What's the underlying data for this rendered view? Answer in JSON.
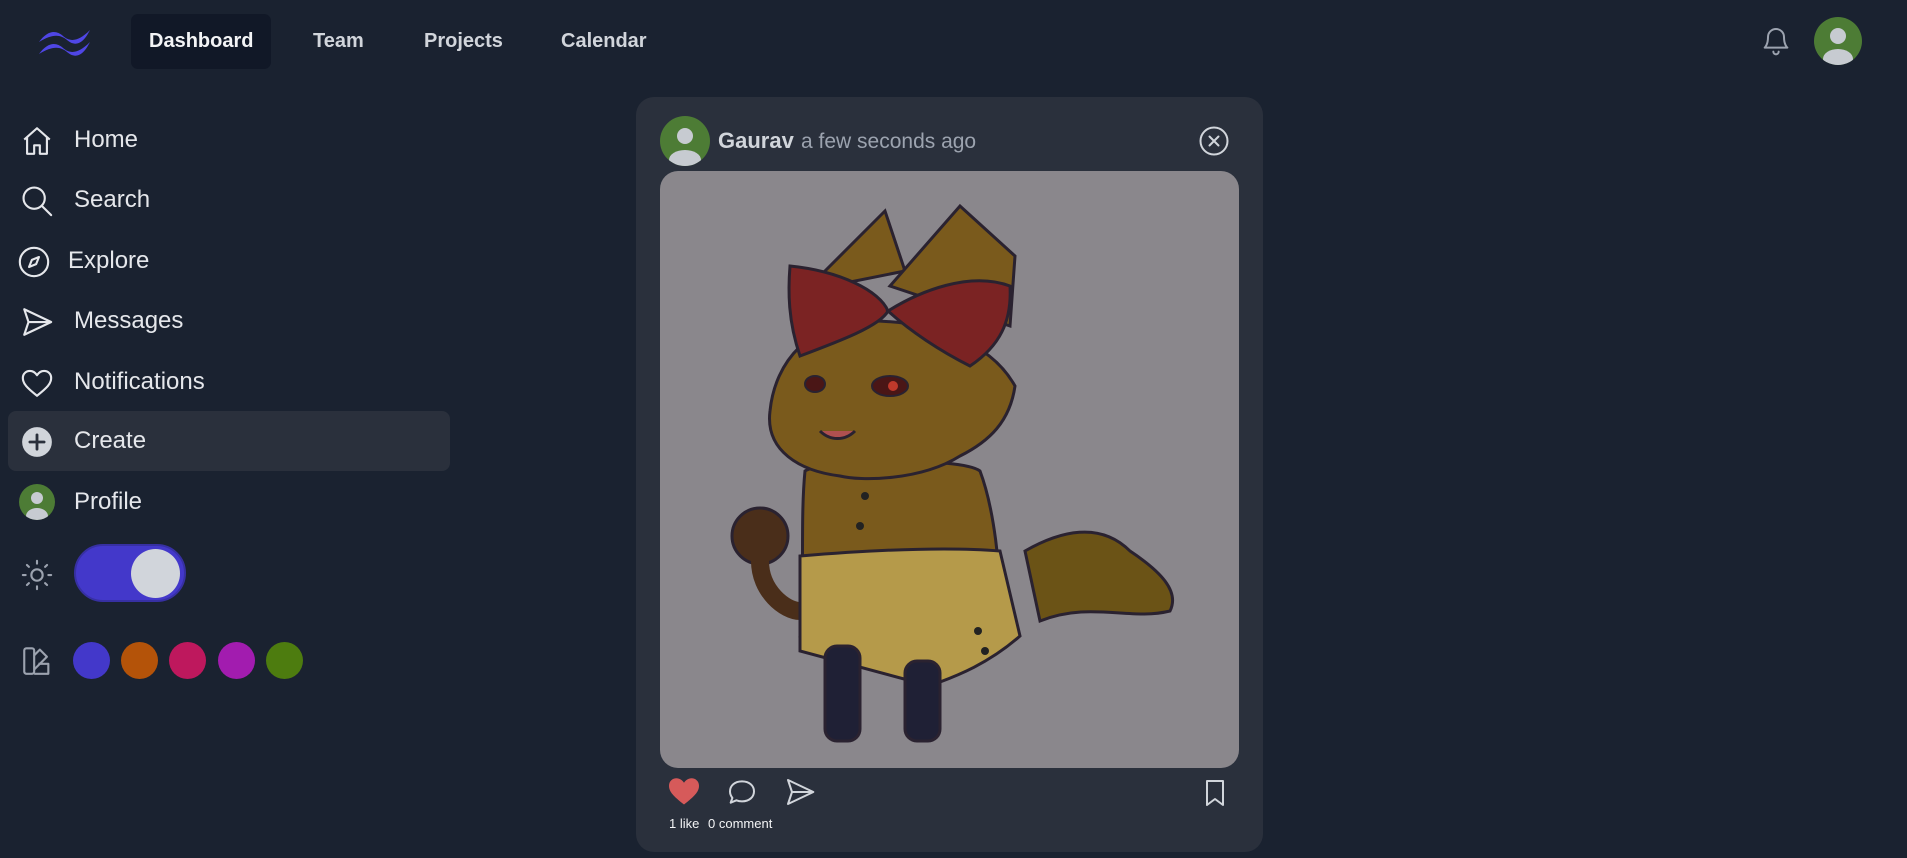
{
  "nav": {
    "tabs": [
      {
        "label": "Dashboard",
        "active": true
      },
      {
        "label": "Team"
      },
      {
        "label": "Projects"
      },
      {
        "label": "Calendar"
      }
    ]
  },
  "sidebar": {
    "items": [
      {
        "label": "Home",
        "icon": "home-icon"
      },
      {
        "label": "Search",
        "icon": "search-icon"
      },
      {
        "label": "Explore",
        "icon": "compass-icon"
      },
      {
        "label": "Messages",
        "icon": "send-icon"
      },
      {
        "label": "Notifications",
        "icon": "heart-icon"
      },
      {
        "label": "Create",
        "icon": "plus-circle-icon",
        "active": true
      },
      {
        "label": "Profile",
        "icon": "avatar-icon"
      }
    ],
    "theme_toggle": {
      "on": true
    },
    "swatches": [
      "#4338ca",
      "#b45309",
      "#be185d",
      "#a21caf",
      "#4d7c0f"
    ]
  },
  "post": {
    "author": "Gaurav",
    "time": "a few seconds ago",
    "likes_label": "1 like",
    "comments_label": "0 comment",
    "liked": true
  },
  "colors": {
    "background": "#1a2230",
    "card": "#2a303c",
    "accent": "#4338ca",
    "like": "#d65a5a"
  }
}
